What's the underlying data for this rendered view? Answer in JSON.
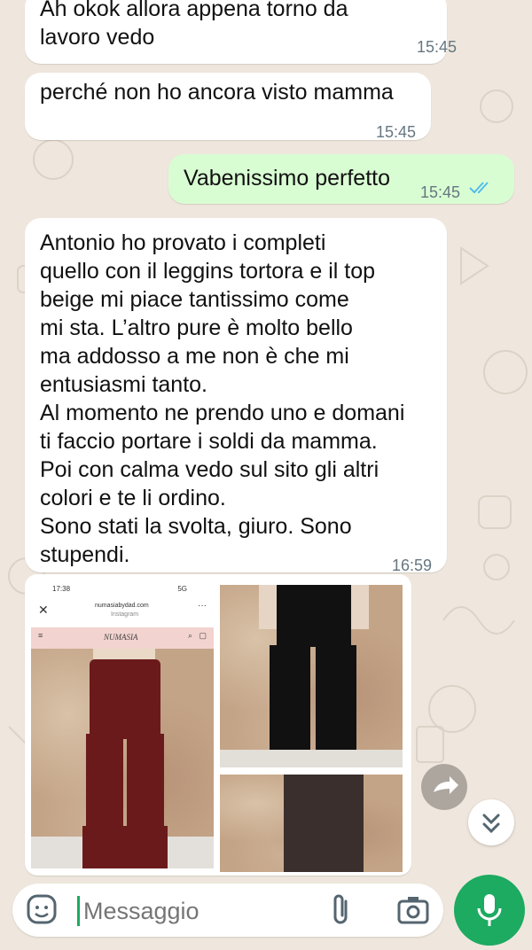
{
  "messages": [
    {
      "dir": "in",
      "text": "Ah okok allora appena torno da\nlavoro vedo",
      "time": "15:45"
    },
    {
      "dir": "in",
      "text": "perché non ho ancora visto mamma",
      "time": "15:45"
    },
    {
      "dir": "out",
      "text": "Vabenissimo perfetto",
      "time": "15:45",
      "status": "read"
    },
    {
      "dir": "in",
      "text": "Antonio ho provato i completi\nquello con il leggins tortora e il top\nbeige mi piace tantissimo come\nmi sta. L’altro pure è molto bello\nma addosso a me non è che mi\nentusiasmi tanto.\nAl momento ne prendo uno e domani\nti faccio portare i soldi da mamma.\nPoi con calma vedo sul sito gli altri\ncolori e te li ordino.\nSono stati la svolta, giuro. Sono\nstupendi.",
      "time": "16:59"
    }
  ],
  "media": {
    "screenshot": {
      "status_time": "17:38",
      "status_right": "5G",
      "domain": "numasiabydad.com",
      "source": "Instagram",
      "brand": "NUMASIA"
    }
  },
  "composer": {
    "placeholder": "Messaggio"
  },
  "icons": [
    "sticker-icon",
    "attach-icon",
    "camera-icon",
    "mic-icon",
    "forward-icon",
    "chevrons-down-icon",
    "double-check-icon"
  ],
  "colors": {
    "incoming": "#ffffff",
    "outgoing": "#d9fdd3",
    "accent": "#1daa61",
    "read_ticks": "#53bdeb",
    "background": "#efe7dd"
  }
}
